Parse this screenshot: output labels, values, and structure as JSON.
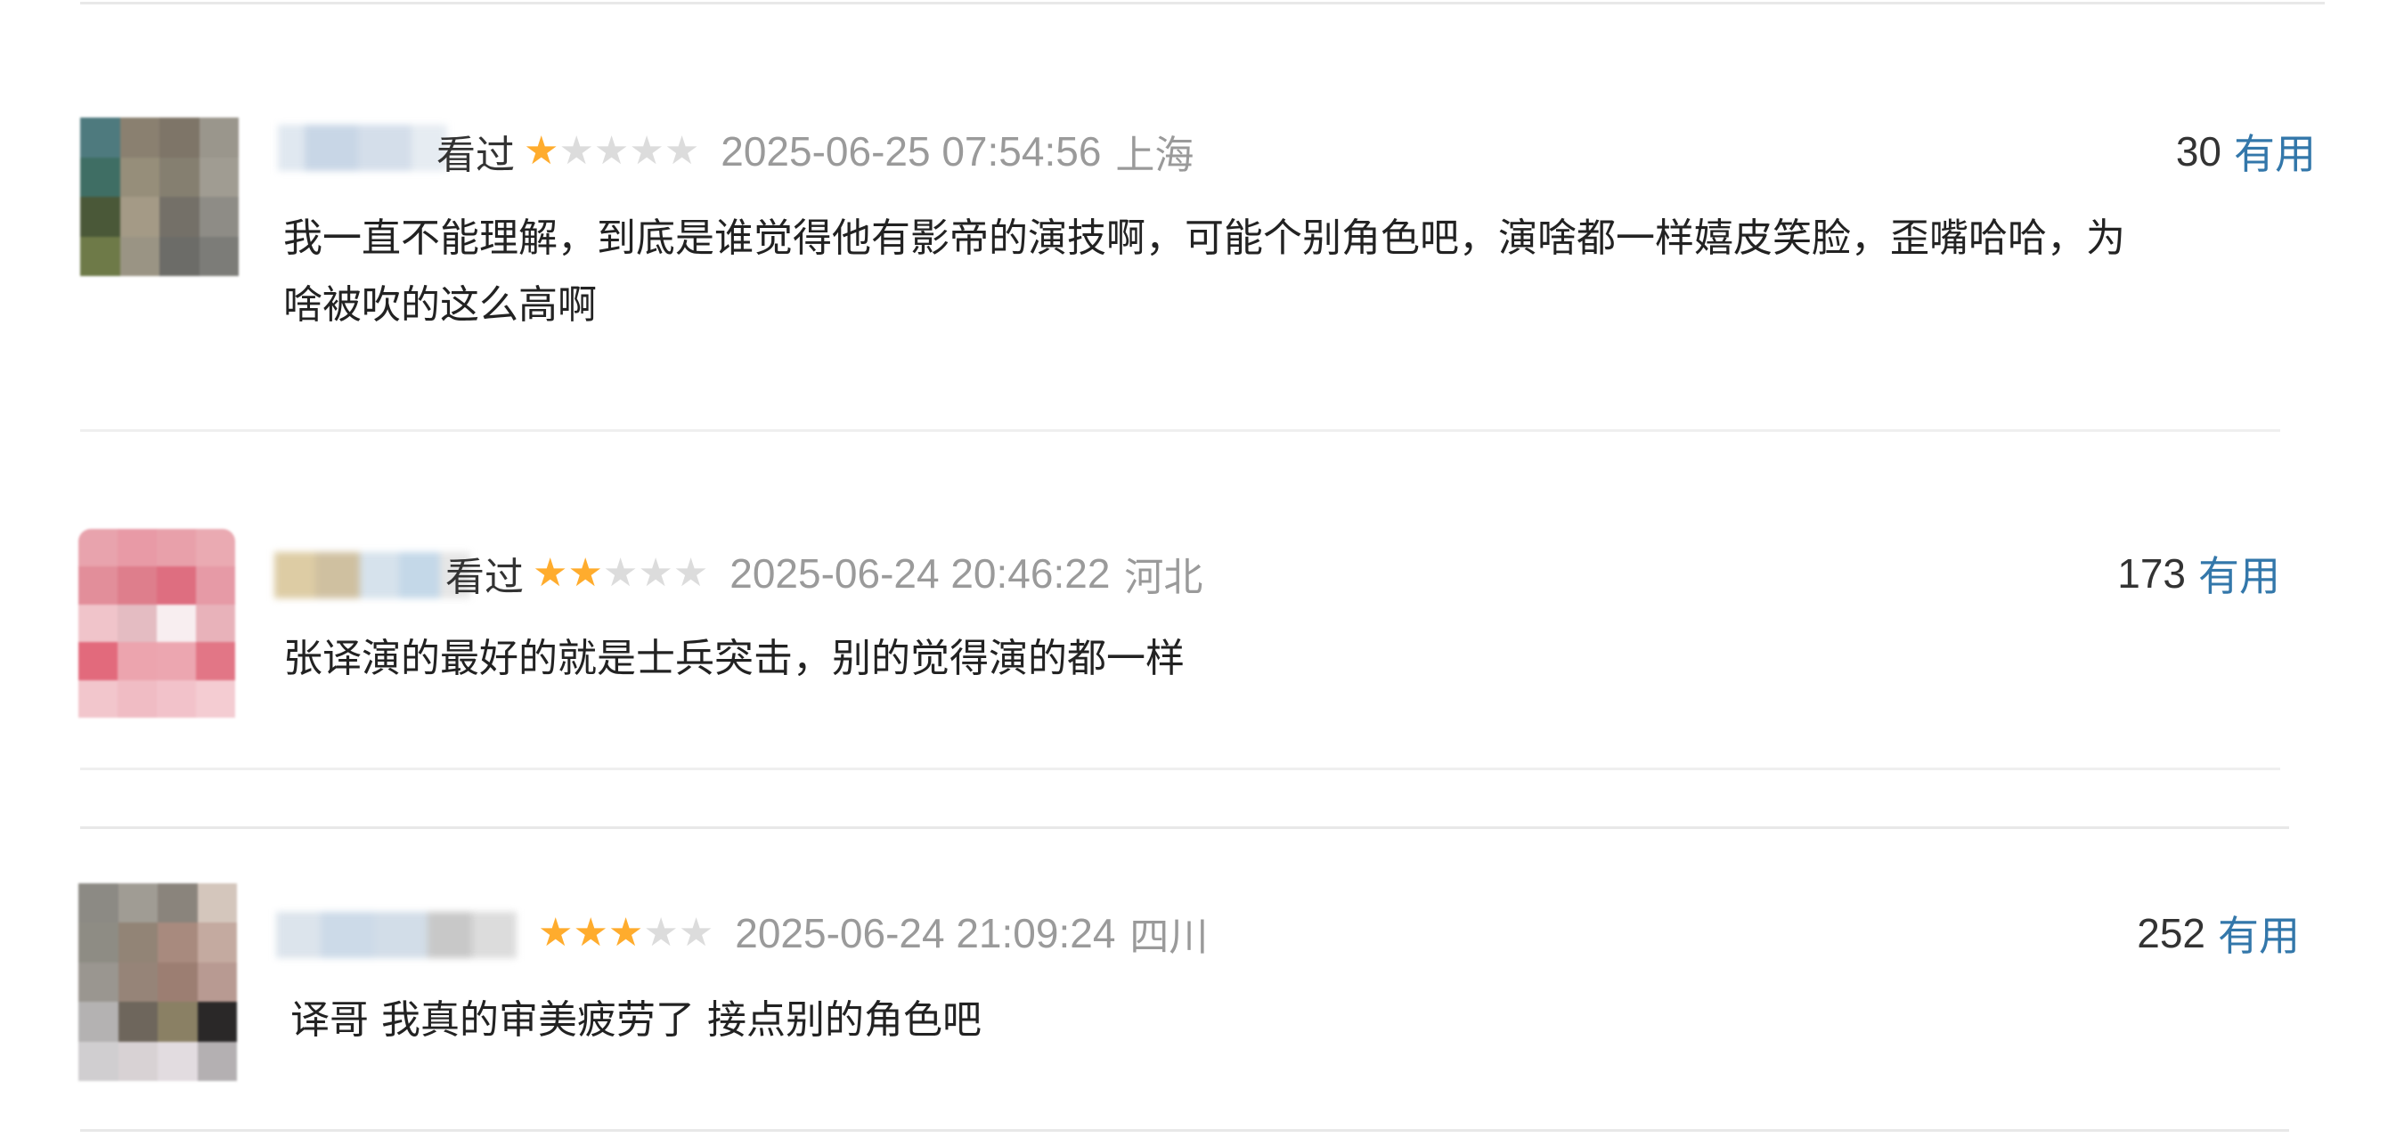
{
  "comments": [
    {
      "status": "看过",
      "rating": 1,
      "rating_max": 5,
      "time": "2025-06-25 07:54:56",
      "location": "上海",
      "votes": "30",
      "useful_label": "有用",
      "content_lines": [
        "我一直不能理解，到底是谁觉得他有影帝的演技啊，可能个别角色吧，演啥都一样嬉皮笑脸，歪嘴哈哈，为",
        "啥被吹的这么高啊"
      ]
    },
    {
      "status": "看过",
      "rating": 2,
      "rating_max": 5,
      "time": "2025-06-24 20:46:22",
      "location": "河北",
      "votes": "173",
      "useful_label": "有用",
      "content_lines": [
        "张译演的最好的就是士兵突击，别的觉得演的都一样"
      ]
    },
    {
      "status": "",
      "rating": 3,
      "rating_max": 5,
      "time": "2025-06-24 21:09:24",
      "location": "四川",
      "votes": "252",
      "useful_label": "有用",
      "content_lines": [
        "译哥 我真的审美疲劳了 接点别的角色吧"
      ]
    }
  ],
  "colors": {
    "star_on": "#ffac2d",
    "star_off": "#dcdcdc",
    "useful_link": "#3377aa",
    "meta_gray": "#9a9a9a"
  }
}
